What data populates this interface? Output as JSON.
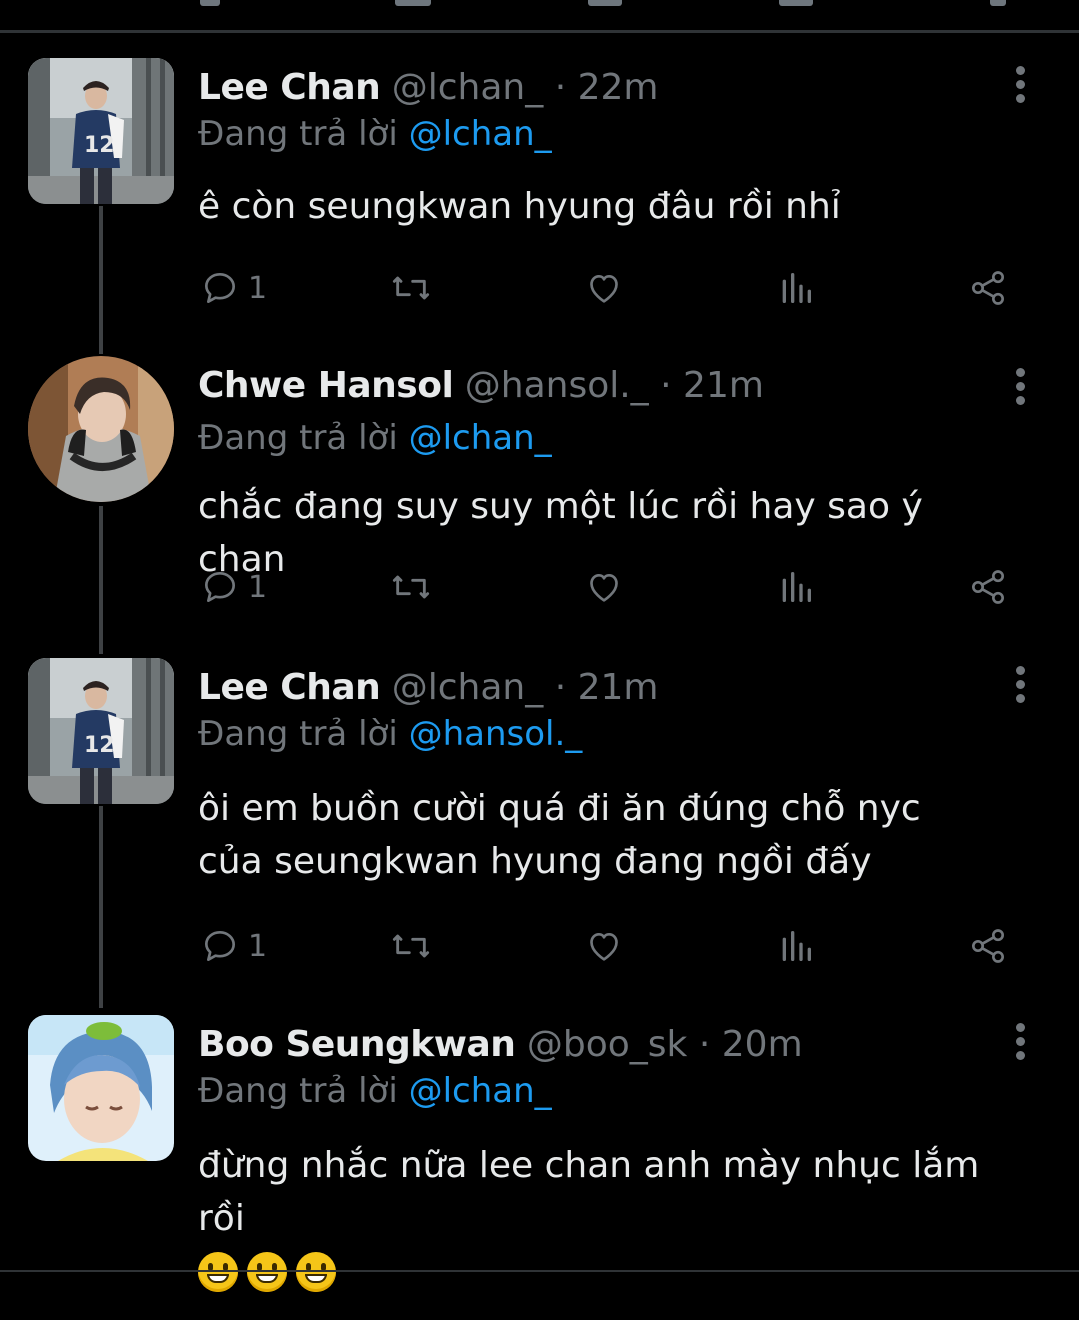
{
  "colors": {
    "background": "#000000",
    "text": "#e7e9ea",
    "muted": "#71767b",
    "mention": "#1d9bf0",
    "thread_line": "#3e4144",
    "divider": "#2f3336"
  },
  "reply_prefix": "Đang trả lời",
  "tweets": [
    {
      "name": "Lee Chan",
      "handle": "@lchan_",
      "separator": "·",
      "time": "22m",
      "reply_to": "@lchan_",
      "body": "ê còn seungkwan hyung đâu rồi nhỉ",
      "reply_count": "1",
      "avatar": "lee-chan-avatar"
    },
    {
      "name": "Chwe Hansol",
      "handle": "@hansol._",
      "separator": "·",
      "time": "21m",
      "reply_to": "@lchan_",
      "body": "chắc đang suy suy một lúc rồi hay sao ý chan",
      "reply_count": "1",
      "avatar": "chwe-hansol-avatar"
    },
    {
      "name": "Lee Chan",
      "handle": "@lchan_",
      "separator": "·",
      "time": "21m",
      "reply_to": "@hansol._",
      "body": "ôi em buồn cười quá đi ăn đúng chỗ nyc của seungkwan hyung đang ngồi đấy",
      "reply_count": "1",
      "avatar": "lee-chan-avatar"
    },
    {
      "name": "Boo Seungkwan",
      "handle": "@boo_sk",
      "separator": "·",
      "time": "20m",
      "reply_to": "@lchan_",
      "body": "đừng nhắc nữa lee chan anh mày nhục lắm rồi",
      "emoji_count": 3,
      "emoji": "grinning-face-emoji",
      "avatar": "boo-seungkwan-avatar"
    }
  ]
}
